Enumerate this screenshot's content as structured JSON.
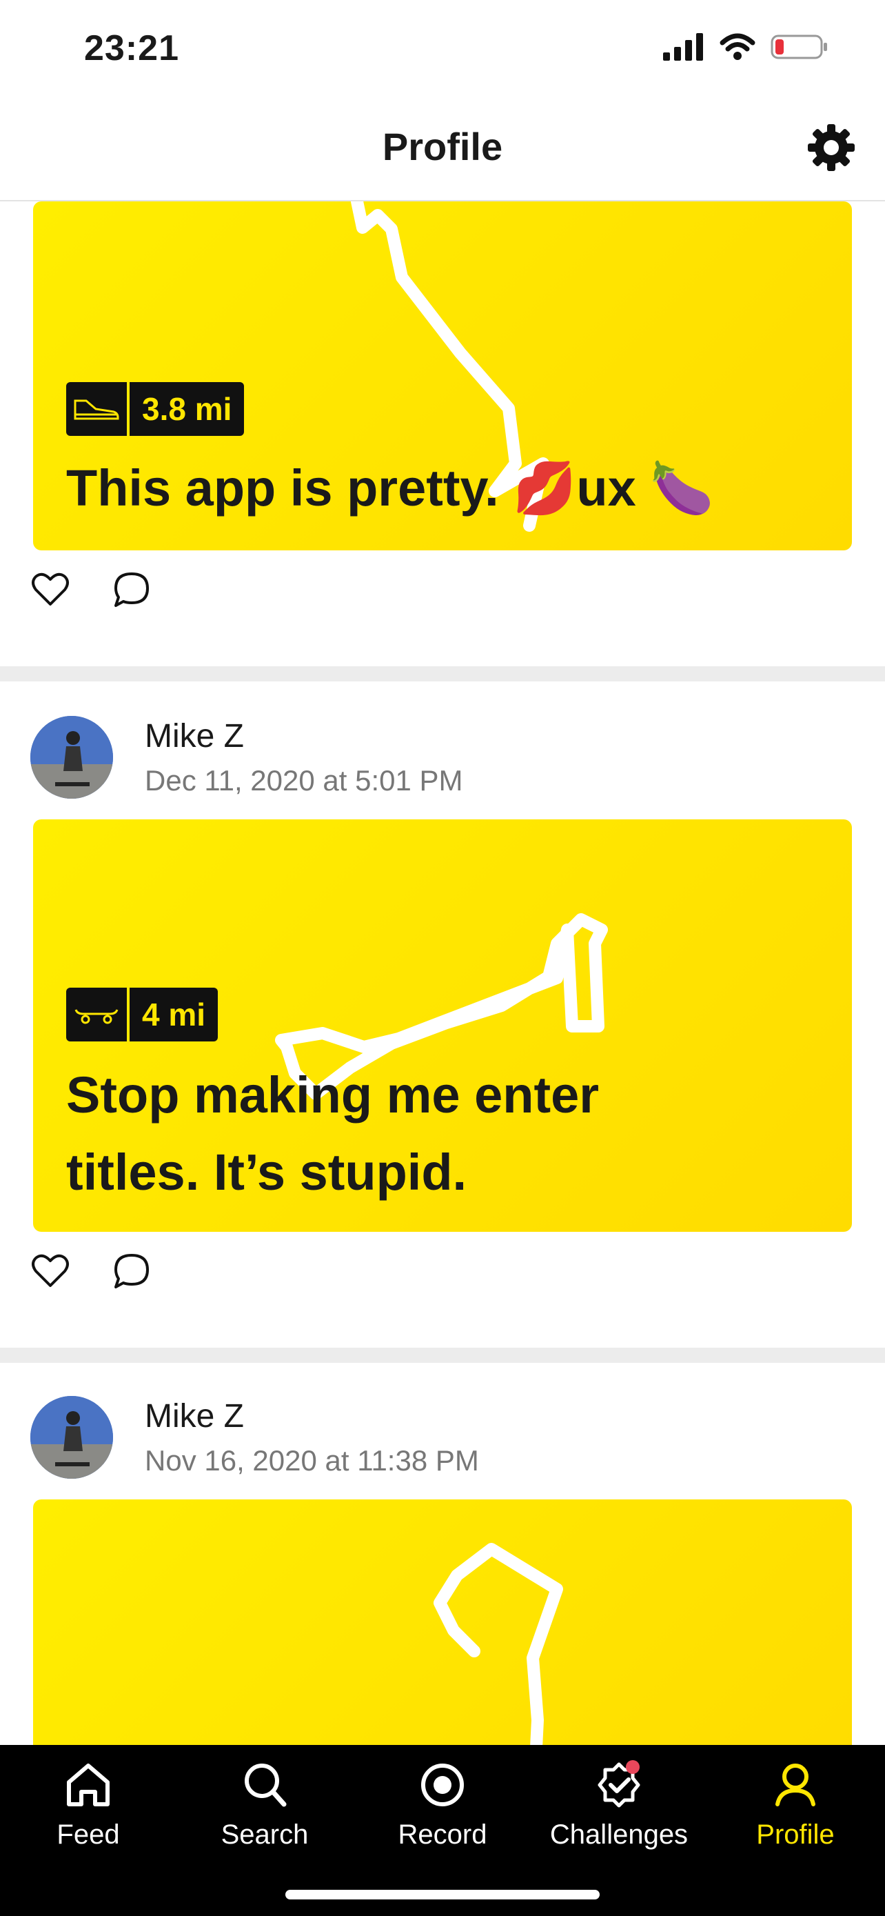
{
  "status": {
    "time": "23:21"
  },
  "header": {
    "title": "Profile"
  },
  "posts": [
    {
      "activity_icon": "shoe-icon",
      "distance": "3.8 mi",
      "title": "This app is pretty. 💋ux 🍆"
    },
    {
      "author": "Mike Z",
      "date": "Dec 11, 2020 at 5:01 PM",
      "activity_icon": "skateboard-icon",
      "distance": "4 mi",
      "title_line1": "Stop making me enter",
      "title_line2": "titles. It’s stupid."
    },
    {
      "author": "Mike Z",
      "date": "Nov 16, 2020 at 11:38 PM"
    }
  ],
  "tabs": [
    {
      "label": "Feed",
      "icon": "home-icon"
    },
    {
      "label": "Search",
      "icon": "search-icon"
    },
    {
      "label": "Record",
      "icon": "record-icon"
    },
    {
      "label": "Challenges",
      "icon": "challenges-icon"
    },
    {
      "label": "Profile",
      "icon": "profile-icon"
    }
  ],
  "colors": {
    "accent": "#ffe600",
    "card": "#ffe100",
    "tabbar": "#000000",
    "notification": "#e8475b"
  }
}
